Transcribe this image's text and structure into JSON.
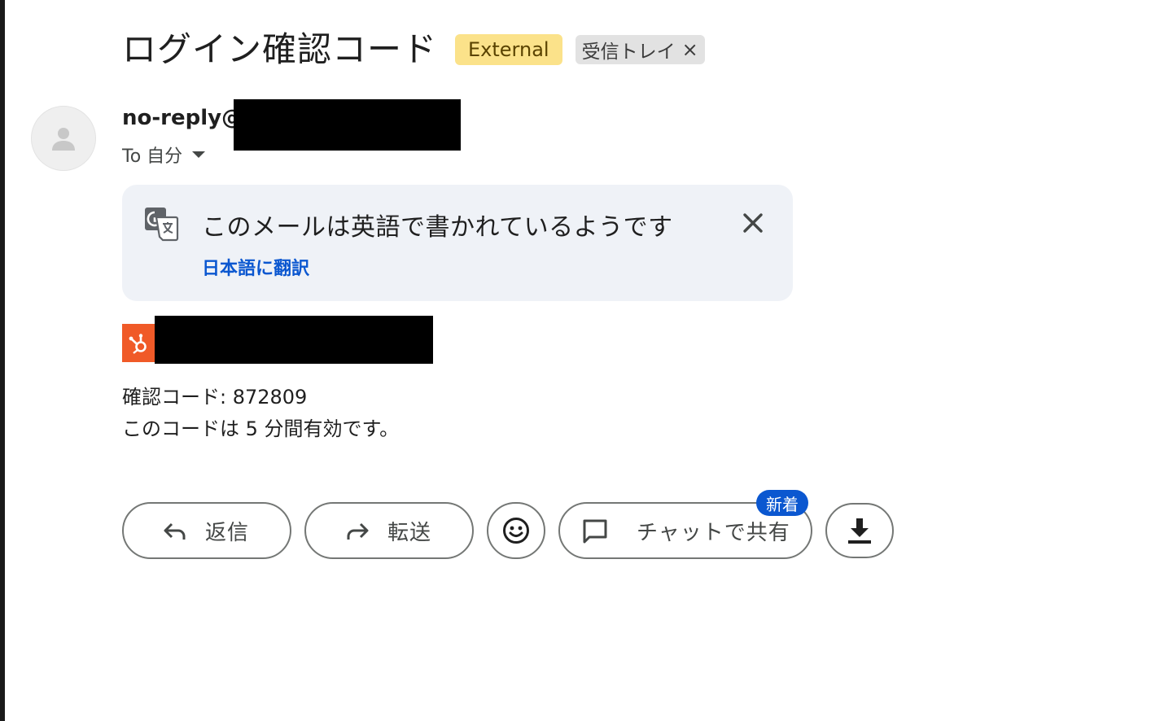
{
  "email": {
    "subject": "ログイン確認コード",
    "labels": {
      "external": "External",
      "inbox": "受信トレイ",
      "inbox_remove": "×"
    },
    "sender": {
      "name": "no-reply@"
    },
    "recipient": "To 自分",
    "translate": {
      "message": "このメールは英語で書かれているようです",
      "link": "日本語に翻訳"
    },
    "body": {
      "line1": "確認コード: 872809",
      "line2": "このコードは 5 分間有効です。"
    }
  },
  "actions": {
    "reply": "返信",
    "forward": "転送",
    "chat_share": "チャットで共有",
    "new_badge": "新着"
  },
  "icons": {
    "avatar": "person-icon",
    "translate": "translate-icon",
    "close": "close-icon",
    "reply": "reply-arrow-icon",
    "forward": "forward-arrow-icon",
    "emoji": "emoji-smile-icon",
    "chat": "chat-bubble-icon",
    "download": "download-icon",
    "brand": "hubspot-logo"
  },
  "colors": {
    "external_chip": "#fbe28a",
    "inbox_chip": "#e2e2e2",
    "translate_card": "#eff2f7",
    "link_blue": "#0b57d0",
    "brand_orange": "#f05a28"
  }
}
